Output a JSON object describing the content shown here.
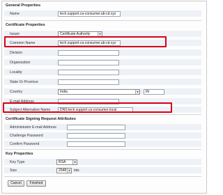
{
  "general": {
    "title": "General Properties",
    "name_label": "Name",
    "name_value": "tech.support.ca-consumer.ab-cd.xyz"
  },
  "cert": {
    "title": "Certificate Properties",
    "issuer_label": "Issuer",
    "issuer_value": "Certificate Authority",
    "common_name_label": "Common Name",
    "common_name_value": "tech.support.ca-consumer.ab-cd.xyz",
    "division_label": "Division",
    "organization_label": "Organization",
    "locality_label": "Locality",
    "state_label": "State Or Province",
    "country_label": "Country",
    "country_value": "India",
    "country_code": "IN",
    "email_label": "E-mail Address",
    "san_label": "Subject Alternative Name",
    "san_value": "DNS:tech.support.ca-consumer.local"
  },
  "csr": {
    "title": "Certificate Signing Request Attributes",
    "admin_email_label": "Administrator E-mail Address",
    "challenge_label": "Challenge Password",
    "confirm_label": "Confirm Password"
  },
  "key": {
    "title": "Key Properties",
    "type_label": "Key Type",
    "type_value": "RSA",
    "size_label": "Size",
    "size_value": "2048",
    "size_unit": "bits"
  },
  "buttons": {
    "cancel": "Cancel",
    "finished": "Finished"
  },
  "colors": {
    "highlight": "#d4001a",
    "row_background": "#eef1f6"
  }
}
